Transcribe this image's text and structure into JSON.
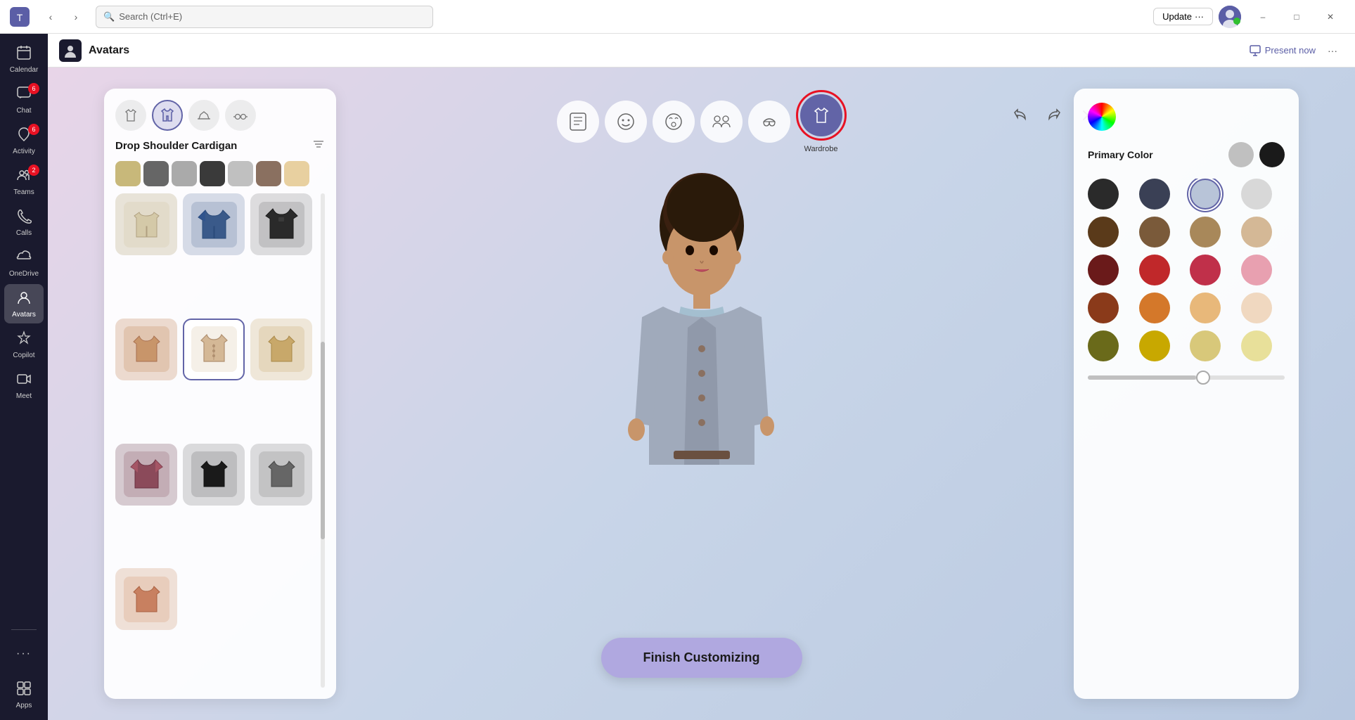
{
  "titlebar": {
    "search_placeholder": "Search (Ctrl+E)",
    "update_label": "Update",
    "update_dots": "···",
    "minimize_label": "–",
    "maximize_label": "□",
    "close_label": "✕"
  },
  "sidebar": {
    "items": [
      {
        "id": "calendar",
        "label": "Calendar",
        "icon": "📅",
        "badge": null
      },
      {
        "id": "chat",
        "label": "Chat",
        "icon": "💬",
        "badge": "6"
      },
      {
        "id": "activity",
        "label": "Activity",
        "icon": "🔔",
        "badge": "6"
      },
      {
        "id": "teams",
        "label": "Teams",
        "icon": "👥",
        "badge": "2"
      },
      {
        "id": "calls",
        "label": "Calls",
        "icon": "📞",
        "badge": null
      },
      {
        "id": "onedrive",
        "label": "OneDrive",
        "icon": "☁",
        "badge": null
      },
      {
        "id": "avatars",
        "label": "Avatars",
        "icon": "🧑",
        "badge": null,
        "active": true
      },
      {
        "id": "copilot",
        "label": "Copilot",
        "icon": "⬡",
        "badge": null
      },
      {
        "id": "meet",
        "label": "Meet",
        "icon": "📹",
        "badge": null
      },
      {
        "id": "more",
        "label": "···",
        "icon": "···",
        "badge": null
      },
      {
        "id": "apps",
        "label": "Apps",
        "icon": "⊞",
        "badge": null
      }
    ]
  },
  "app_header": {
    "title": "Avatars",
    "present_label": "Present now",
    "more_icon": "···"
  },
  "avatar_toolbar": {
    "buttons": [
      {
        "id": "pose",
        "icon": "🖼",
        "label": ""
      },
      {
        "id": "face",
        "icon": "😊",
        "label": ""
      },
      {
        "id": "reactions",
        "icon": "🎭",
        "label": ""
      },
      {
        "id": "groups",
        "icon": "👥",
        "label": ""
      },
      {
        "id": "accessories",
        "icon": "🎩",
        "label": ""
      },
      {
        "id": "wardrobe",
        "icon": "👕",
        "label": "Wardrobe",
        "active": true,
        "selected": true
      }
    ]
  },
  "left_panel": {
    "tabs": [
      {
        "id": "tops",
        "icon": "👕"
      },
      {
        "id": "jackets",
        "icon": "🧥",
        "active": true
      },
      {
        "id": "hats",
        "icon": "🎩"
      },
      {
        "id": "glasses",
        "icon": "👓"
      }
    ],
    "title": "Drop Shoulder Cardigan",
    "items": [
      {
        "id": 1,
        "color": "#d4c9a8",
        "emoji": "🧥"
      },
      {
        "id": 2,
        "color": "#3a5a8a",
        "emoji": "🧥"
      },
      {
        "id": 3,
        "color": "#2a2a2a",
        "emoji": "🧥"
      },
      {
        "id": 4,
        "color": "#c8956a",
        "emoji": "🧥"
      },
      {
        "id": 5,
        "color": "#d4b896",
        "emoji": "🧥",
        "selected": true
      },
      {
        "id": 6,
        "color": "#c8a86a",
        "emoji": "🧥"
      },
      {
        "id": 7,
        "color": "#8b4a5a",
        "emoji": "🧥"
      },
      {
        "id": 8,
        "color": "#1a1a1a",
        "emoji": "🧥"
      },
      {
        "id": 9,
        "color": "#666666",
        "emoji": "🧥"
      },
      {
        "id": 10,
        "color": "#d4956a",
        "emoji": "🧥"
      }
    ]
  },
  "right_panel": {
    "primary_color_label": "Primary Color",
    "presets": [
      {
        "color": "#c0c0c0",
        "selected": false
      },
      {
        "color": "#1a1a1a",
        "selected": false
      }
    ],
    "swatches": [
      {
        "color": "#2a2a2a",
        "row": 0
      },
      {
        "color": "#3a3a4a",
        "row": 0
      },
      {
        "color": "#b8c4d8",
        "row": 0,
        "selected": true
      },
      {
        "color": "#d8d8d8",
        "row": 0
      },
      {
        "color": "#5a3a1a",
        "row": 1
      },
      {
        "color": "#7a5a3a",
        "row": 1
      },
      {
        "color": "#a8885a",
        "row": 1
      },
      {
        "color": "#d4b896",
        "row": 1
      },
      {
        "color": "#6a1a1a",
        "row": 2
      },
      {
        "color": "#c0282a",
        "row": 2
      },
      {
        "color": "#c0304a",
        "row": 2
      },
      {
        "color": "#e8a0b0",
        "row": 2
      },
      {
        "color": "#8a3a1a",
        "row": 3
      },
      {
        "color": "#d4782a",
        "row": 3
      },
      {
        "color": "#e8b87a",
        "row": 3
      },
      {
        "color": "#f0d8c0",
        "row": 3
      },
      {
        "color": "#6a6a1a",
        "row": 4
      },
      {
        "color": "#c8a800",
        "row": 4
      },
      {
        "color": "#d8c87a",
        "row": 4
      },
      {
        "color": "#e8e09a",
        "row": 4
      }
    ],
    "slider_value": 55
  },
  "finish_button": {
    "label": "Finish Customizing"
  }
}
